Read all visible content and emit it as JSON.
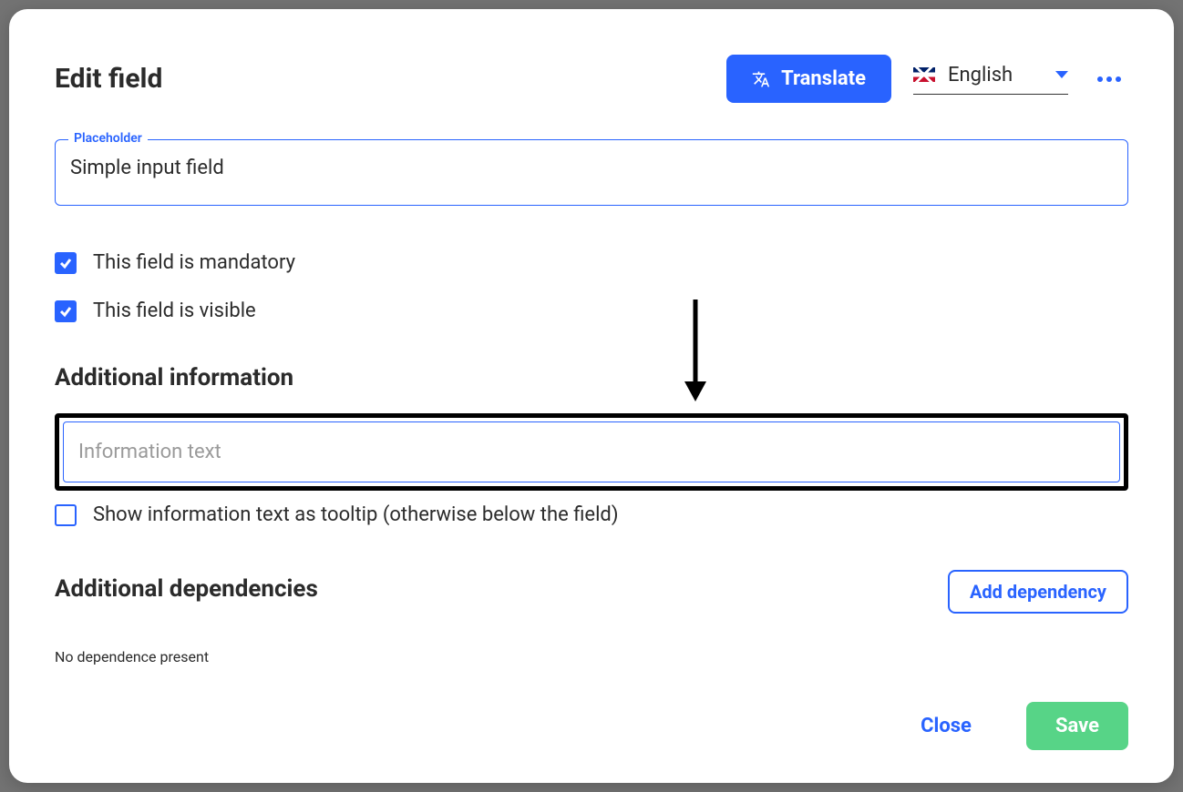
{
  "header": {
    "title": "Edit field",
    "translate_label": "Translate",
    "language": "English"
  },
  "placeholder_field": {
    "label": "Placeholder",
    "value": "Simple input field"
  },
  "checks": {
    "mandatory": "This field is mandatory",
    "visible": "This field is visible"
  },
  "additional_info": {
    "heading": "Additional information",
    "info_placeholder": "Information text",
    "tooltip_label": "Show information text as tooltip (otherwise below the field)"
  },
  "dependencies": {
    "heading": "Additional dependencies",
    "add_label": "Add dependency",
    "empty": "No dependence present"
  },
  "footer": {
    "close": "Close",
    "save": "Save"
  }
}
